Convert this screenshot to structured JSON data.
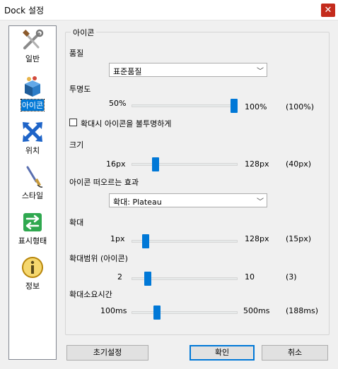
{
  "window": {
    "title": "Dock 설정",
    "close_glyph": "✕"
  },
  "sidebar": {
    "items": [
      {
        "label": "일반",
        "icon": "tools-icon"
      },
      {
        "label": "아이콘",
        "icon": "icon-box-icon"
      },
      {
        "label": "위치",
        "icon": "position-arrows-icon"
      },
      {
        "label": "스타일",
        "icon": "brush-icon"
      },
      {
        "label": "표시형태",
        "icon": "swap-arrows-icon"
      },
      {
        "label": "정보",
        "icon": "info-icon"
      }
    ],
    "selected": "아이콘"
  },
  "group": {
    "title": "아이콘"
  },
  "quality": {
    "label": "품질",
    "value": "표준품질",
    "arrow": "﹀"
  },
  "opacity": {
    "label": "투명도",
    "min": "50%",
    "max": "100%",
    "current": "(100%)",
    "fraction": 1.0
  },
  "checkbox": {
    "label": "확대시 아이콘을 불투명하게",
    "checked": false
  },
  "size": {
    "label": "크기",
    "min": "16px",
    "max": "128px",
    "current": "(40px)",
    "fraction": 0.21
  },
  "effect": {
    "label": "아이콘 떠오르는 효과",
    "value": "확대: Plateau",
    "arrow": "﹀"
  },
  "magnify": {
    "label": "확대",
    "min": "1px",
    "max": "128px",
    "current": "(15px)",
    "fraction": 0.11
  },
  "magnify_range": {
    "label": "확대범위 (아이콘)",
    "min": "2",
    "max": "10",
    "current": "(3)",
    "fraction": 0.125
  },
  "magnify_time": {
    "label": "확대소요시간",
    "min": "100ms",
    "max": "500ms",
    "current": "(188ms)",
    "fraction": 0.22
  },
  "buttons": {
    "reset": "초기설정",
    "ok": "확인",
    "cancel": "취소"
  }
}
